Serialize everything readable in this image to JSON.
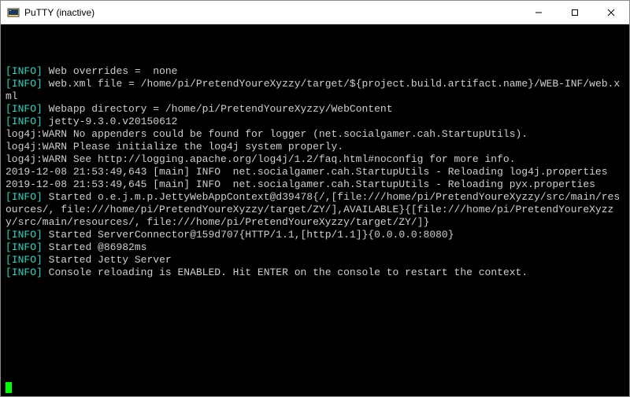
{
  "window": {
    "title": "PuTTY (inactive)"
  },
  "colors": {
    "info_tag": "#3bd1c0",
    "terminal_bg": "#000000",
    "terminal_fg": "#cfcfcf",
    "cursor": "#00ff00"
  },
  "lines": [
    {
      "tag": "INFO",
      "text": " Web overrides =  none"
    },
    {
      "tag": "INFO",
      "text": " web.xml file = /home/pi/PretendYoureXyzzy/target/${project.build.artifact.name}/WEB-INF/web.xml"
    },
    {
      "tag": "INFO",
      "text": " Webapp directory = /home/pi/PretendYoureXyzzy/WebContent"
    },
    {
      "tag": "INFO",
      "text": " jetty-9.3.0.v20150612"
    },
    {
      "tag": null,
      "text": "log4j:WARN No appenders could be found for logger (net.socialgamer.cah.StartupUtils)."
    },
    {
      "tag": null,
      "text": "log4j:WARN Please initialize the log4j system properly."
    },
    {
      "tag": null,
      "text": "log4j:WARN See http://logging.apache.org/log4j/1.2/faq.html#noconfig for more info."
    },
    {
      "tag": null,
      "text": "2019-12-08 21:53:49,643 [main] INFO  net.socialgamer.cah.StartupUtils - Reloading log4j.properties"
    },
    {
      "tag": null,
      "text": "2019-12-08 21:53:49,645 [main] INFO  net.socialgamer.cah.StartupUtils - Reloading pyx.properties"
    },
    {
      "tag": "INFO",
      "text": " Started o.e.j.m.p.JettyWebAppContext@d39478{/,[file:///home/pi/PretendYoureXyzzy/src/main/resources/, file:///home/pi/PretendYoureXyzzy/target/ZY/],AVAILABLE}{[file:///home/pi/PretendYoureXyzzy/src/main/resources/, file:///home/pi/PretendYoureXyzzy/target/ZY/]}"
    },
    {
      "tag": "INFO",
      "text": " Started ServerConnector@159d707{HTTP/1.1,[http/1.1]}{0.0.0.0:8080}"
    },
    {
      "tag": "INFO",
      "text": " Started @86982ms"
    },
    {
      "tag": "INFO",
      "text": " Started Jetty Server"
    },
    {
      "tag": "INFO",
      "text": " Console reloading is ENABLED. Hit ENTER on the console to restart the context."
    }
  ]
}
